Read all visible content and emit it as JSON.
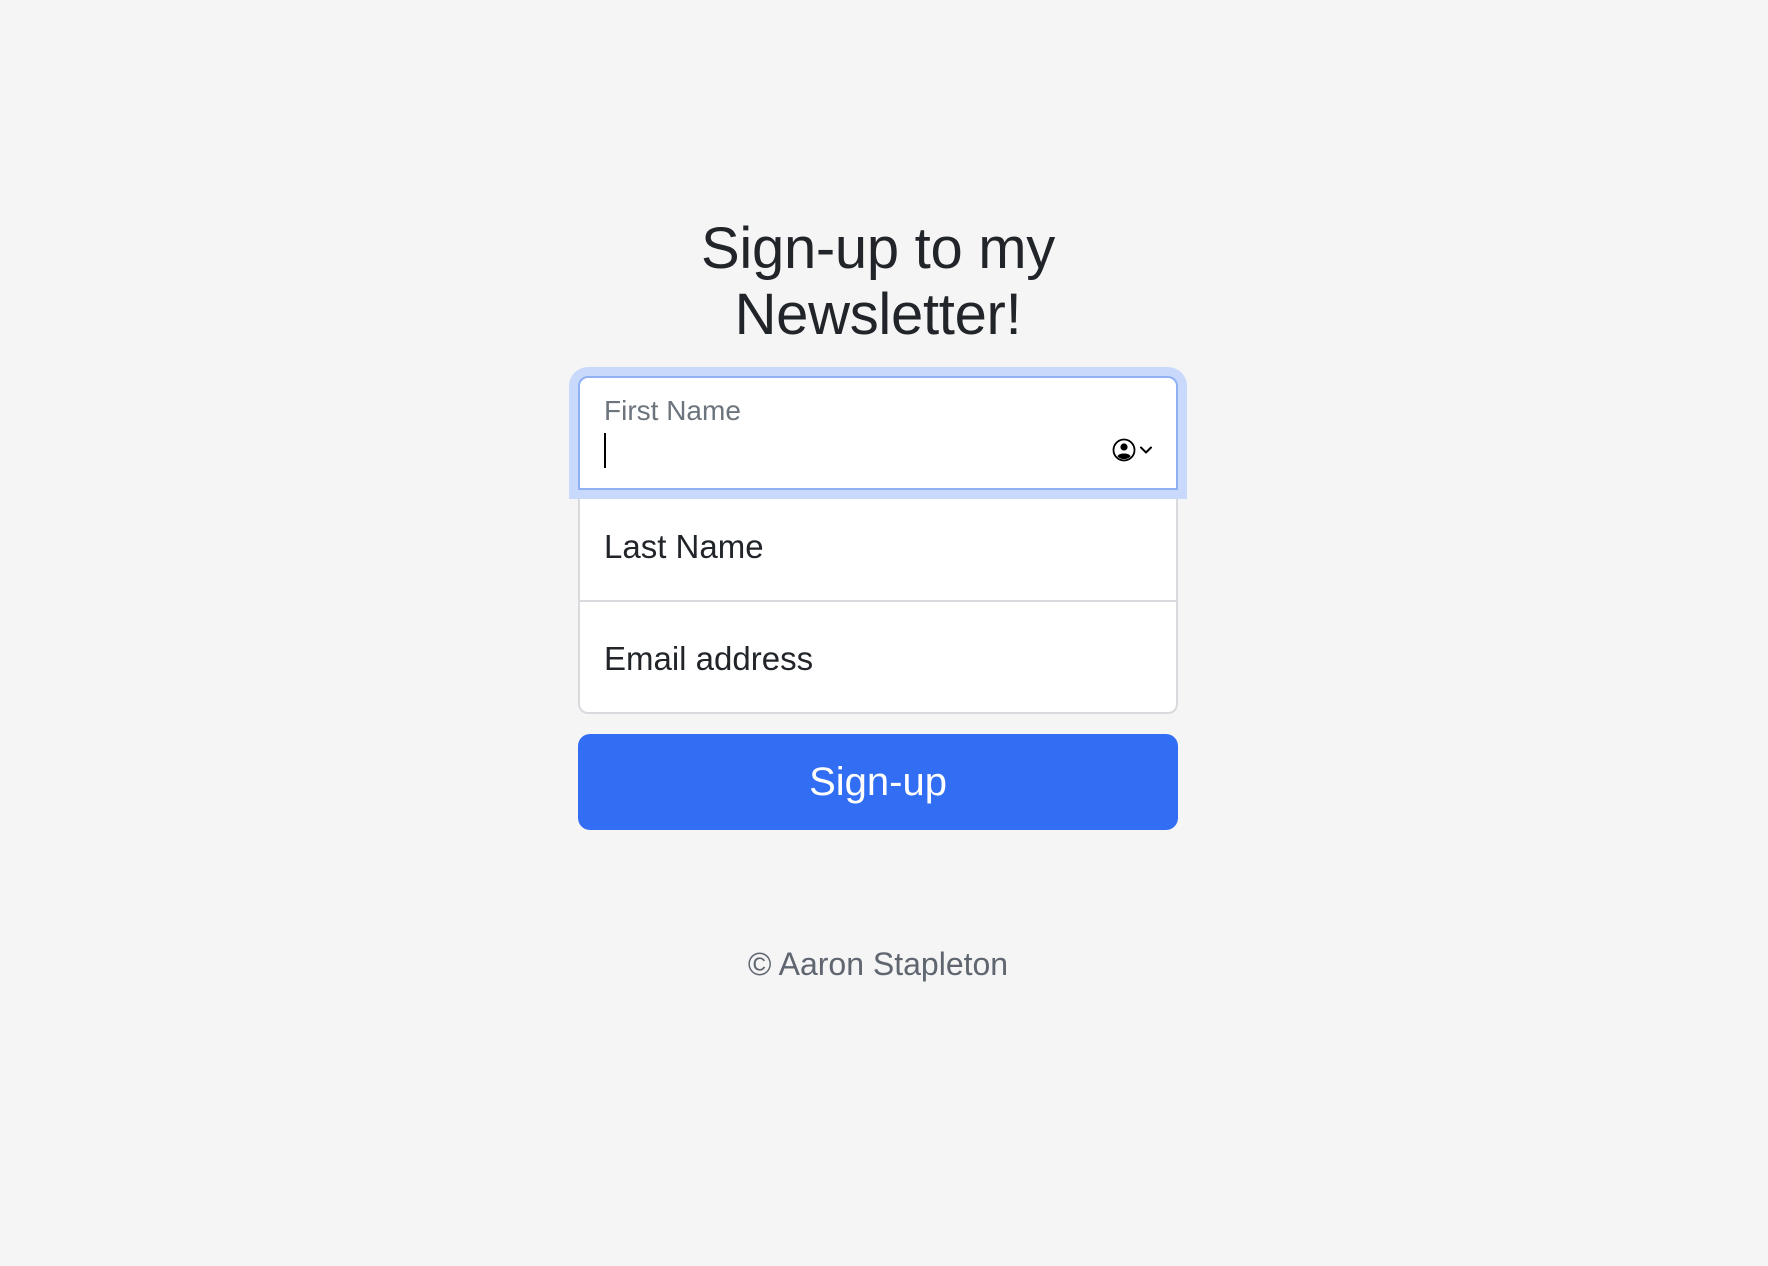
{
  "header": {
    "title_line1": "Sign-up to my",
    "title_line2": "Newsletter!"
  },
  "form": {
    "first_name": {
      "label": "First Name",
      "value": "",
      "autofill_icon": "contact-card-autofill-icon"
    },
    "last_name": {
      "placeholder": "Last Name",
      "value": ""
    },
    "email": {
      "placeholder": "Email address",
      "value": ""
    },
    "submit_label": "Sign-up"
  },
  "footer": {
    "copyright": "© Aaron Stapleton"
  },
  "colors": {
    "page_background": "#f5f5f5",
    "primary_button": "#316ef4",
    "focus_ring": "#c9d9fb",
    "focus_border": "#8fb1f4"
  }
}
